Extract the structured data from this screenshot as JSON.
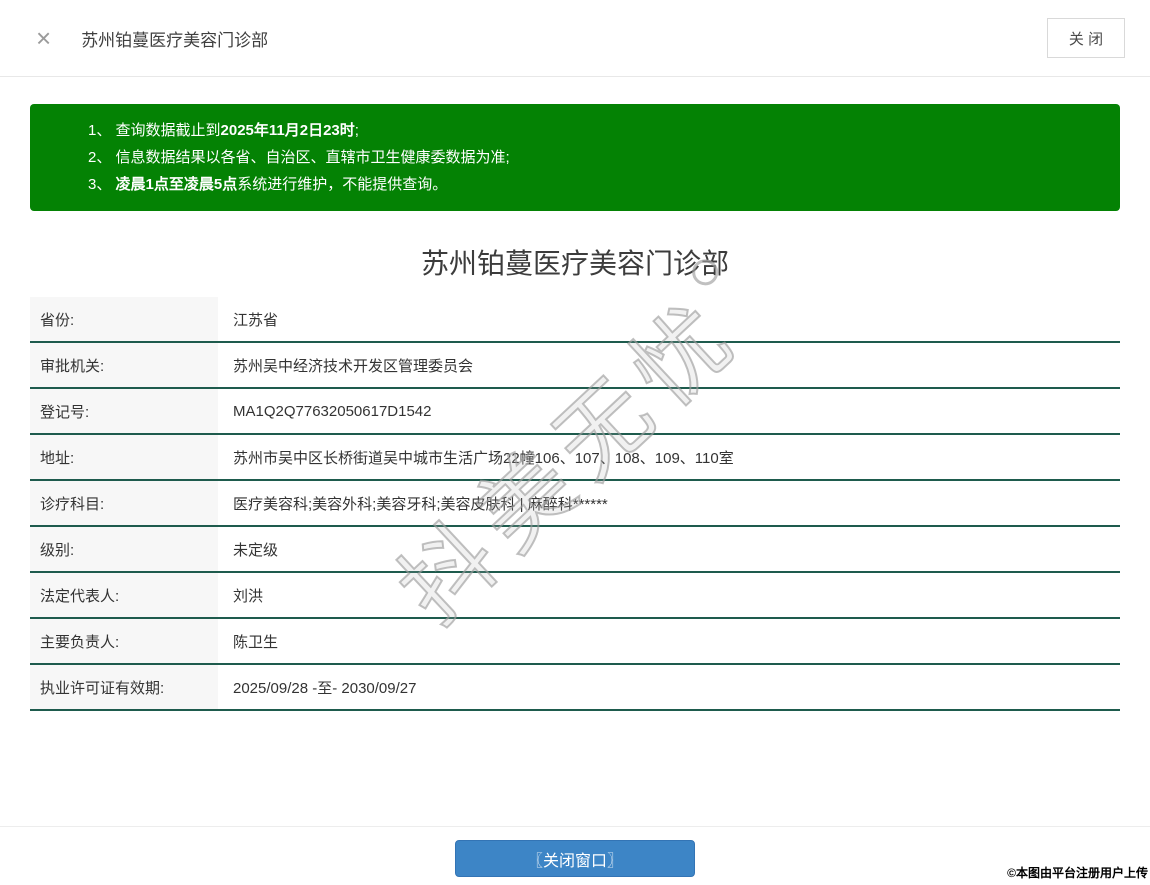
{
  "header": {
    "close_icon": "×",
    "title": "苏州铂蔓医疗美容门诊部",
    "close_button_label": "关 闭"
  },
  "notice": {
    "lines": [
      {
        "parts": [
          {
            "text": "1、 查询数据截止到",
            "bold": false
          },
          {
            "text": "2025年11月2日23时",
            "bold": true
          },
          {
            "text": ";",
            "bold": false
          }
        ]
      },
      {
        "parts": [
          {
            "text": "2、 信息数据结果以各省、自治区、直辖市卫生健康委数据为准;",
            "bold": false
          }
        ]
      },
      {
        "parts": [
          {
            "text": "3、 ",
            "bold": false
          },
          {
            "text": "凌晨1点至凌晨5点",
            "bold": true
          },
          {
            "text": "系统进行维护，不能提供查询。",
            "bold": false
          }
        ]
      }
    ]
  },
  "detail": {
    "title": "苏州铂蔓医疗美容门诊部",
    "rows": [
      {
        "label": "省份:",
        "value": "江苏省"
      },
      {
        "label": "审批机关:",
        "value": "苏州吴中经济技术开发区管理委员会"
      },
      {
        "label": "登记号:",
        "value": "MA1Q2Q77632050617D1542"
      },
      {
        "label": "地址:",
        "value": "苏州市吴中区长桥街道吴中城市生活广场22幢106、107、108、109、110室"
      },
      {
        "label": "诊疗科目:",
        "value": "医疗美容科;美容外科;美容牙科;美容皮肤科 | 麻醉科******"
      },
      {
        "label": "级别:",
        "value": "未定级"
      },
      {
        "label": "法定代表人:",
        "value": "刘洪"
      },
      {
        "label": "主要负责人:",
        "value": "陈卫生"
      },
      {
        "label": "执业许可证有效期:",
        "value": "2025/09/28 -至- 2030/09/27"
      }
    ]
  },
  "watermark": {
    "text": "抖美无忧"
  },
  "footer": {
    "close_button_label": "〖关闭窗口〗",
    "copyright": "©本图由平台注册用户上传"
  },
  "colors": {
    "notice_bg": "#048204",
    "row_separator": "#1e5b4d",
    "label_bg": "#f7f7f7",
    "footer_button_bg": "#3d85c6"
  }
}
